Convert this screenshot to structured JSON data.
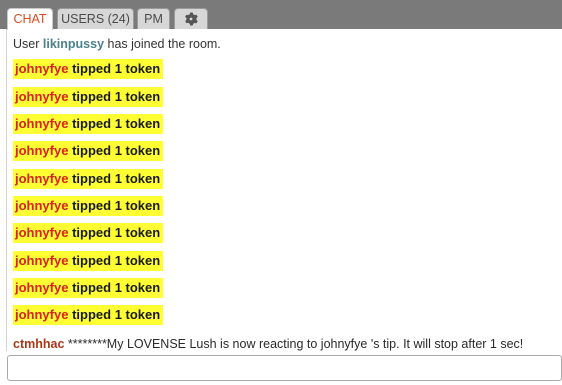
{
  "tabs": {
    "chat": "CHAT",
    "users": "USERS (24)",
    "pm": "PM",
    "settings_icon": "gear-icon"
  },
  "colors": {
    "tab_bar": "#7a7a7a",
    "active_tab_text": "#dc4a22",
    "tip_highlight": "#ffff33",
    "tip_username": "#dc1f1f",
    "join_username": "#4b7f8c",
    "chat_username": "#a9391a"
  },
  "system_message": {
    "prefix": "User",
    "username": "likinpussy",
    "suffix": "has joined the room."
  },
  "tips": [
    {
      "user": "johnyfye",
      "text": "tipped 1 token"
    },
    {
      "user": "johnyfye",
      "text": "tipped 1 token"
    },
    {
      "user": "johnyfye",
      "text": "tipped 1 token"
    },
    {
      "user": "johnyfye",
      "text": "tipped 1 token"
    },
    {
      "user": "johnyfye",
      "text": "tipped 1 token"
    },
    {
      "user": "johnyfye",
      "text": "tipped 1 token"
    },
    {
      "user": "johnyfye",
      "text": "tipped 1 token"
    },
    {
      "user": "johnyfye",
      "text": "tipped 1 token"
    },
    {
      "user": "johnyfye",
      "text": "tipped 1 token"
    },
    {
      "user": "johnyfye",
      "text": "tipped 1 token"
    }
  ],
  "message": {
    "username": "ctmhhac",
    "text": "********My LOVENSE Lush is now reacting to johnyfye 's tip. It will stop after 1 sec!"
  },
  "input": {
    "value": "",
    "placeholder": ""
  }
}
